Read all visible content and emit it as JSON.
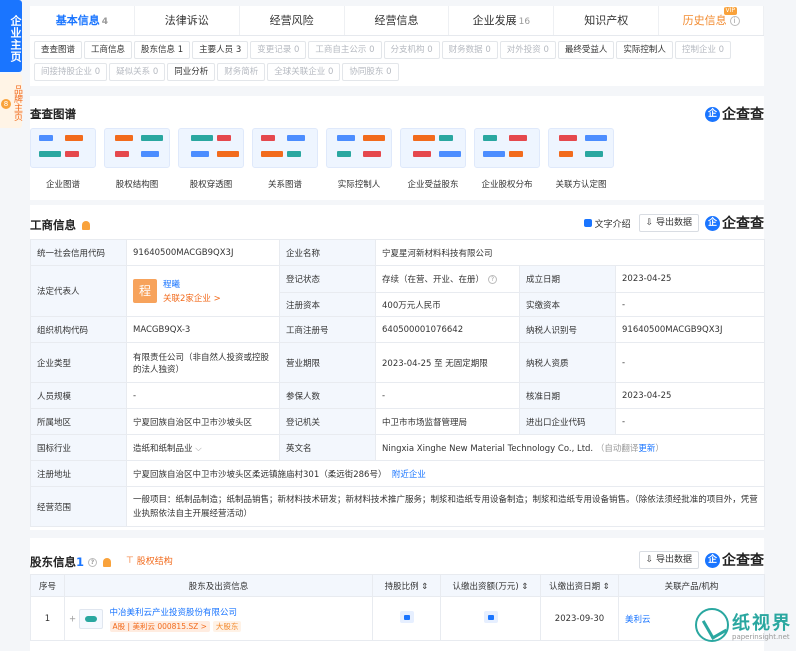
{
  "side": {
    "main_label": "企业主页",
    "sub_label": "品牌主页",
    "sub_badge": "8"
  },
  "tabs": [
    {
      "label": "基本信息",
      "count": "4",
      "active": true
    },
    {
      "label": "法律诉讼",
      "count": ""
    },
    {
      "label": "经营风险",
      "count": ""
    },
    {
      "label": "经营信息",
      "count": ""
    },
    {
      "label": "企业发展",
      "count": "16"
    },
    {
      "label": "知识产权",
      "count": ""
    },
    {
      "label": "历史信息",
      "count": "",
      "vip": "VIP"
    }
  ],
  "subtabs": [
    {
      "label": "查查图谱",
      "enabled": true
    },
    {
      "label": "工商信息",
      "enabled": true
    },
    {
      "label": "股东信息 1",
      "enabled": true
    },
    {
      "label": "主要人员 3",
      "enabled": true
    },
    {
      "label": "变更记录 0",
      "enabled": false
    },
    {
      "label": "工商自主公示 0",
      "enabled": false
    },
    {
      "label": "分支机构 0",
      "enabled": false
    },
    {
      "label": "财务数据 0",
      "enabled": false
    },
    {
      "label": "对外投资 0",
      "enabled": false
    },
    {
      "label": "最终受益人",
      "enabled": true
    },
    {
      "label": "实际控制人",
      "enabled": true
    },
    {
      "label": "控制企业 0",
      "enabled": false
    },
    {
      "label": "间接持股企业 0",
      "enabled": false
    },
    {
      "label": "疑似关系 0",
      "enabled": false
    },
    {
      "label": "同业分析",
      "enabled": true
    },
    {
      "label": "财务简析",
      "enabled": false
    },
    {
      "label": "全球关联企业 0",
      "enabled": false
    },
    {
      "label": "协同股东 0",
      "enabled": false
    }
  ],
  "brand": {
    "logo_glyph": "企",
    "text": "企查查"
  },
  "graph": {
    "title": "查查图谱",
    "items": [
      "企业图谱",
      "股权结构图",
      "股权穿透图",
      "关系图谱",
      "实际控制人",
      "企业受益股东",
      "企业股权分布",
      "关联方认定图"
    ]
  },
  "biz": {
    "title": "工商信息",
    "text_intro": "文字介绍",
    "export": "导出数据",
    "credit_code_k": "统一社会信用代码",
    "credit_code_v": "91640500MACGB9QX3J",
    "name_k": "企业名称",
    "name_v": "宁夏星河新材料科技有限公司",
    "legal_rep_k": "法定代表人",
    "legal_rep_avatar": "程",
    "legal_rep_name": "程曦",
    "legal_rep_link": "关联2家企业 >",
    "reg_status_k": "登记状态",
    "reg_status_v": "存续（在营、开业、在册）",
    "est_date_k": "成立日期",
    "est_date_v": "2023-04-25",
    "reg_capital_k": "注册资本",
    "reg_capital_v": "400万元人民币",
    "paid_capital_k": "实缴资本",
    "paid_capital_v": "-",
    "org_code_k": "组织机构代码",
    "org_code_v": "MACGB9QX-3",
    "biz_reg_no_k": "工商注册号",
    "biz_reg_no_v": "640500001076642",
    "taxpayer_id_k": "纳税人识别号",
    "taxpayer_id_v": "91640500MACGB9QX3J",
    "type_k": "企业类型",
    "type_v": "有限责任公司（非自然人投资或控股的法人独资）",
    "term_k": "营业期限",
    "term_v": "2023-04-25 至 无固定期限",
    "taxpayer_q_k": "纳税人资质",
    "taxpayer_q_v": "-",
    "staff_k": "人员规模",
    "staff_v": "-",
    "insured_k": "参保人数",
    "insured_v": "-",
    "approve_k": "核准日期",
    "approve_v": "2023-04-25",
    "region_k": "所属地区",
    "region_v": "宁夏回族自治区中卫市沙坡头区",
    "authority_k": "登记机关",
    "authority_v": "中卫市市场监督管理局",
    "ie_code_k": "进出口企业代码",
    "ie_code_v": "-",
    "industry_k": "国标行业",
    "industry_v": "造纸和纸制品业",
    "en_name_k": "英文名",
    "en_name_v": "Ningxia Xinghe New Material Technology Co., Ltd.",
    "en_auto": "（自动翻译",
    "en_update": "更新",
    "en_close": "）",
    "address_k": "注册地址",
    "address_v": "宁夏回族自治区中卫市沙坡头区柔远镇施庙村301（柔远街286号）",
    "address_link": "附近企业",
    "scope_k": "经营范围",
    "scope_v": "一般项目：纸制品制造；纸制品销售；新材料技术研发；新材料技术推广服务；制浆和造纸专用设备制造；制浆和造纸专用设备销售。（除依法须经批准的项目外，凭营业执照依法自主开展经营活动）"
  },
  "share": {
    "title": "股东信息",
    "count": "1",
    "structure_link": "股权结构",
    "export": "导出数据",
    "headers": [
      "序号",
      "股东及出资信息",
      "持股比例 ⇕",
      "认缴出资额(万元) ⇕",
      "认缴出资日期 ⇕",
      "关联产品/机构"
    ],
    "rows": [
      {
        "idx": "1",
        "name": "中冶美利云产业投资股份有限公司",
        "tag_a": "A股 | 美利云 000815.SZ >",
        "tag_b": "大股东",
        "date": "2023-09-30",
        "product": "美利云"
      }
    ]
  },
  "watermark": {
    "cn": "纸视界",
    "en": "paperinsight.net"
  }
}
